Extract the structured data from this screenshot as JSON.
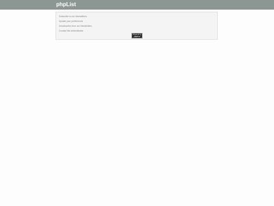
{
  "header": {
    "brand": "phpList"
  },
  "panel": {
    "links": [
      "Subscribe to our Newsletters",
      "Update your preferences",
      "Unsubscribe from our Newsletters",
      "Contact the administrator"
    ],
    "badge": {
      "top_text": "Powered by",
      "bottom_text": "phpList"
    }
  },
  "colors": {
    "topbar": "#8c9693",
    "page_background": "#fdfdfd",
    "panel_background": "#f4f4f4"
  }
}
